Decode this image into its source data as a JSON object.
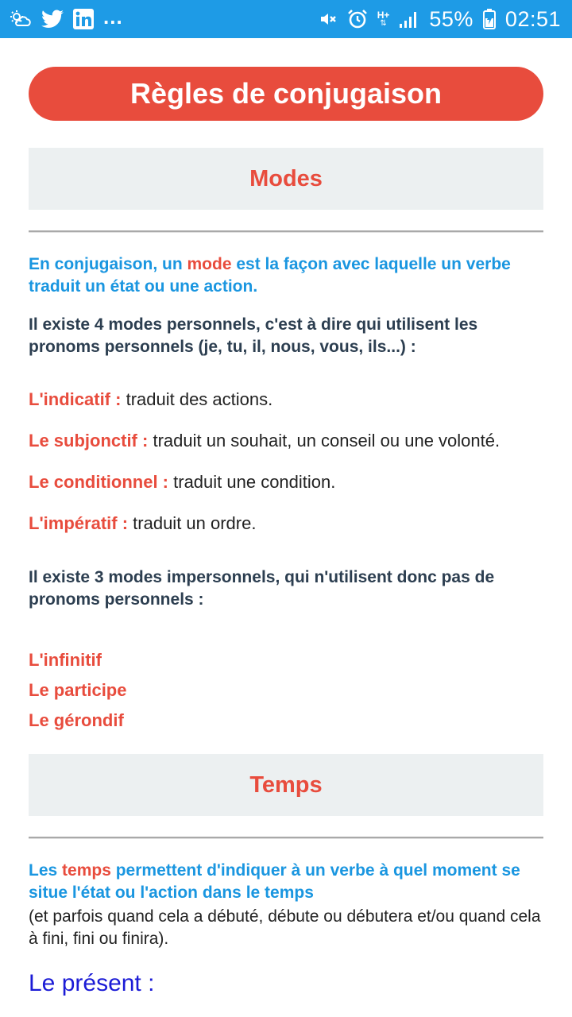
{
  "status_bar": {
    "dots": "...",
    "battery": "55%",
    "time": "02:51",
    "network": "H+",
    "icons": [
      "cloud-sun-icon",
      "twitter-icon",
      "linkedin-icon",
      "mute-icon",
      "alarm-icon",
      "network-type-icon",
      "signal-icon",
      "battery-icon"
    ],
    "background": "#1e9be6"
  },
  "page": {
    "title": "Règles de conjugaison",
    "accent": "#e84c3d",
    "blue": "#1a96e0"
  },
  "modes": {
    "header": "Modes",
    "intro_before": "En conjugaison, un ",
    "intro_highlight": "mode",
    "intro_after": " est la façon avec laquelle un verbe traduit un état ou une action.",
    "personal_intro": "Il existe 4 modes personnels, c'est à dire qui utilisent les pronoms personnels (je, tu, il, nous, vous, ils...) :",
    "personal": [
      {
        "term": "L'indicatif :",
        "desc": "traduit des actions."
      },
      {
        "term": "Le subjonctif :",
        "desc": "traduit un souhait, un conseil ou une volonté."
      },
      {
        "term": "Le conditionnel :",
        "desc": "traduit une condition."
      },
      {
        "term": "L'impératif :",
        "desc": "traduit un ordre."
      }
    ],
    "impersonal_intro": "Il existe 3 modes impersonnels, qui n'utilisent donc pas de pronoms personnels :",
    "impersonal": [
      "L'infinitif",
      "Le participe",
      "Le gérondif"
    ]
  },
  "temps": {
    "header": "Temps",
    "intro_before": "Les ",
    "intro_highlight": "temps",
    "intro_after": " permettent d'indiquer à un verbe à quel moment se situe l'état ou l'action dans le temps",
    "note": "(et parfois quand cela a débuté, débute ou débutera et/ou quand cela à fini, fini ou finira).",
    "present_heading": "Le présent :"
  }
}
